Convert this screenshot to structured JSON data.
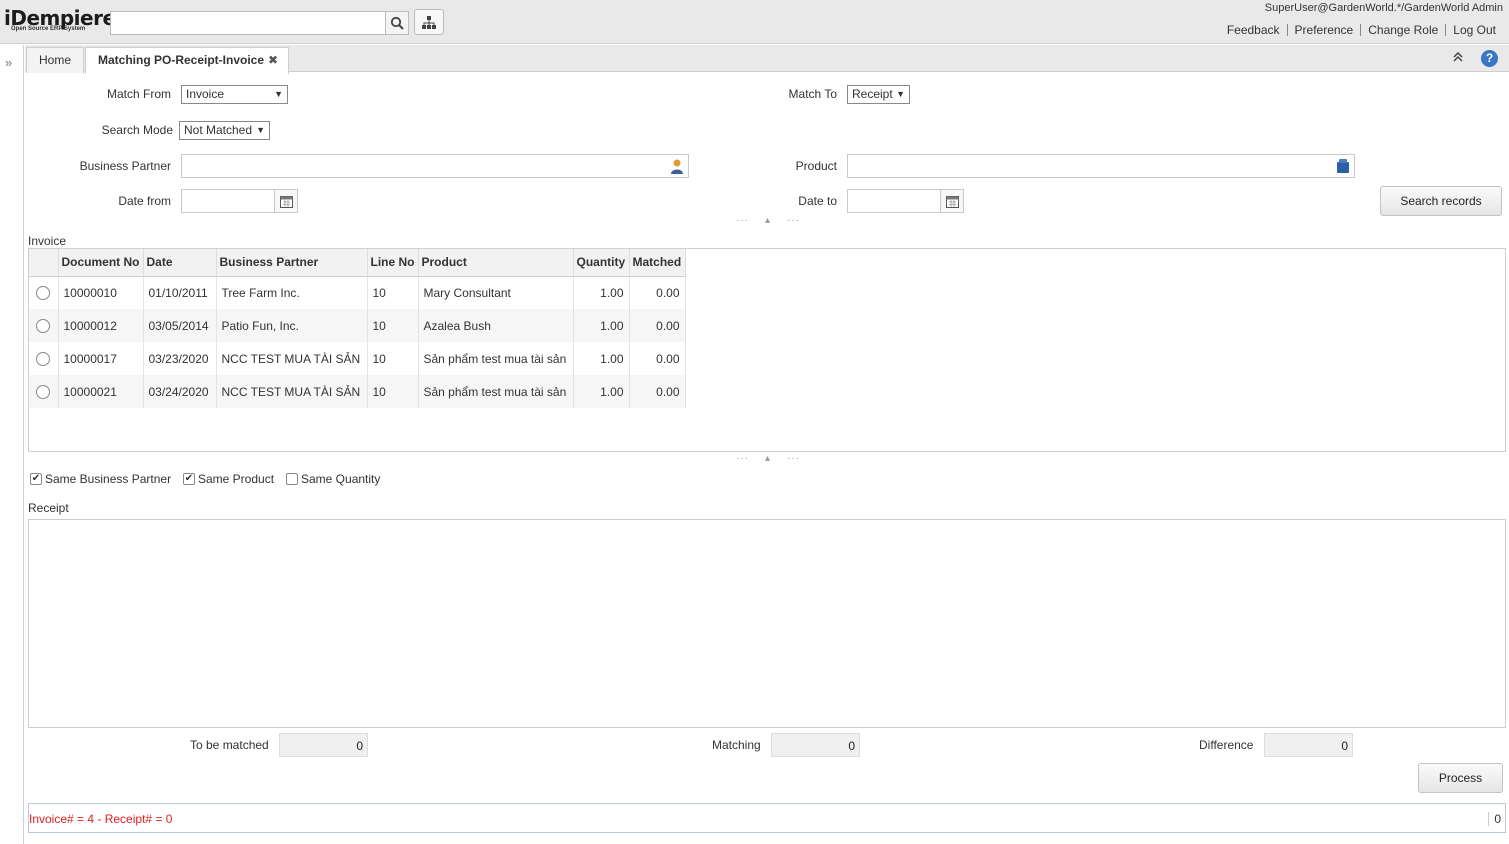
{
  "app": {
    "logo_text": "iDempiere",
    "logo_subtext": "Open Source ERP System",
    "user_info": "SuperUser@GardenWorld.*/GardenWorld Admin",
    "links": {
      "feedback": "Feedback",
      "preference": "Preference",
      "change_role": "Change Role",
      "logout": "Log Out"
    },
    "search_value": ""
  },
  "tabs": {
    "home": "Home",
    "active": "Matching PO-Receipt-Invoice",
    "close_glyph": "✖"
  },
  "form": {
    "match_from_label": "Match From",
    "match_from_value": "Invoice",
    "match_to_label": "Match To",
    "match_to_value": "Receipt",
    "search_mode_label": "Search Mode",
    "search_mode_value": "Not Matched",
    "bpartner_label": "Business Partner",
    "bpartner_value": "",
    "product_label": "Product",
    "product_value": "",
    "date_from_label": "Date from",
    "date_from_value": "",
    "date_to_label": "Date to",
    "date_to_value": "",
    "search_button": "Search records"
  },
  "invoice": {
    "title": "Invoice",
    "columns": [
      "Document No",
      "Date",
      "Business Partner",
      "Line No",
      "Product",
      "Quantity",
      "Matched"
    ],
    "rows": [
      {
        "doc": "10000010",
        "date": "01/10/2011",
        "bp": "Tree Farm Inc.",
        "line": "10",
        "product": "Mary Consultant",
        "qty": "1.00",
        "matched": "0.00"
      },
      {
        "doc": "10000012",
        "date": "03/05/2014",
        "bp": "Patio Fun, Inc.",
        "line": "10",
        "product": "Azalea Bush",
        "qty": "1.00",
        "matched": "0.00"
      },
      {
        "doc": "10000017",
        "date": "03/23/2020",
        "bp": "NCC TEST MUA TÀI SẢN",
        "line": "10",
        "product": "Sản phẩm test mua tài sản",
        "qty": "1.00",
        "matched": "0.00"
      },
      {
        "doc": "10000021",
        "date": "03/24/2020",
        "bp": "NCC TEST MUA TÀI SẢN",
        "line": "10",
        "product": "Sản phẩm test mua tài sản",
        "qty": "1.00",
        "matched": "0.00"
      }
    ]
  },
  "options": {
    "same_bp": "Same Business Partner",
    "same_bp_checked": true,
    "same_product": "Same Product",
    "same_product_checked": true,
    "same_qty": "Same Quantity",
    "same_qty_checked": false
  },
  "receipt": {
    "title": "Receipt"
  },
  "summary": {
    "to_be_matched_label": "To be matched",
    "to_be_matched_value": "0",
    "matching_label": "Matching",
    "matching_value": "0",
    "difference_label": "Difference",
    "difference_value": "0",
    "process_button": "Process"
  },
  "status": {
    "text": "Invoice# = 4 - Receipt# = 0",
    "count": "0"
  },
  "colors": {
    "status_text": "#e02020",
    "help_icon": "#3a76c8"
  }
}
